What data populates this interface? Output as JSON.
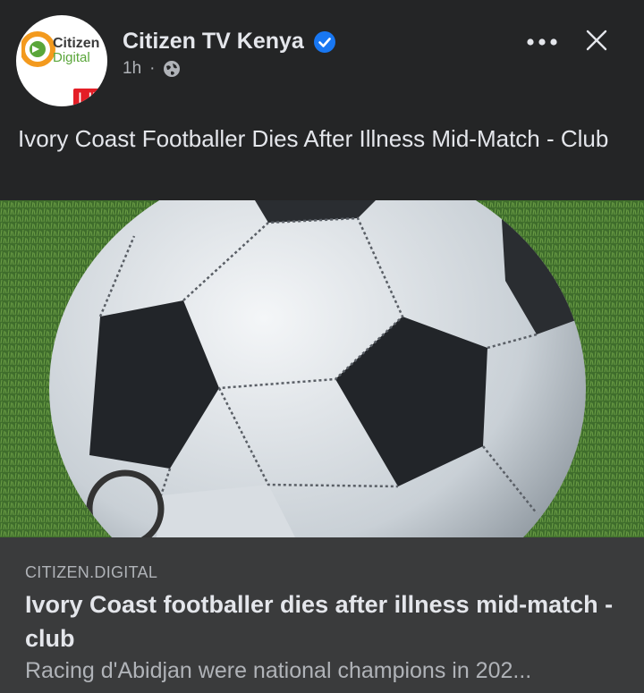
{
  "post": {
    "page_name": "Citizen TV Kenya",
    "verified_icon": "verified-badge-icon",
    "timestamp": "1h",
    "separator": "·",
    "audience_icon": "globe-icon",
    "more_icon": "more-options-icon",
    "close_icon": "close-icon",
    "text": "Ivory Coast Footballer Dies After Illness Mid-Match - Club"
  },
  "avatar": {
    "logo_line1": "Citizen",
    "logo_line2": "Digital",
    "live_label": "LIVE"
  },
  "link_preview": {
    "domain": "CITIZEN.DIGITAL",
    "title": "Ivory Coast footballer dies after illness mid-match - club",
    "description": "Racing d'Abidjan were national champions in 202..."
  },
  "colors": {
    "background": "#242526",
    "preview_background": "#3a3b3c",
    "verified_blue": "#1877f2",
    "live_red": "#e41e26",
    "brand_orange": "#f39a1e",
    "brand_green": "#5aa63a"
  }
}
